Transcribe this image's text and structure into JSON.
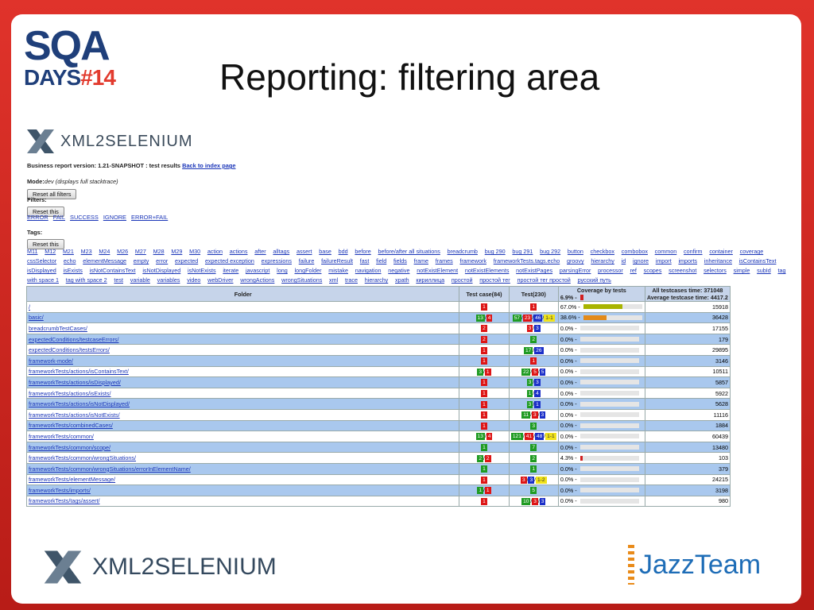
{
  "slide": {
    "title": "Reporting: filtering area",
    "logo_sqa_text": "SQA",
    "logo_days_text": "DAYS",
    "logo_number": "#14",
    "bottom_left_logo": "XML2SELENIUM",
    "bottom_right_logo": "JazzTeam"
  },
  "report": {
    "logo_text": "XML2SELENIUM",
    "version_line": "Business report version: 1.21-SNAPSHOT : test results",
    "back_link": "Back to index page",
    "mode_label": "Mode:",
    "mode_value": "dev (displays full stacktrace)",
    "reset_all_filters": "Reset all filters",
    "filters_label": "Filters:",
    "reset_this_1": "Reset this",
    "filter_links": [
      "ERROR",
      "FAIL",
      "SUCCESS",
      "IGNORE",
      "ERROR+FAIL"
    ],
    "tags_label": "Tags:",
    "reset_this_2": "Reset this",
    "tags": [
      "M11",
      "M12",
      "M21",
      "M23",
      "M24",
      "M26",
      "M27",
      "M28",
      "M29",
      "M30",
      "action",
      "actions",
      "after",
      "alltags",
      "assert",
      "base",
      "bdd",
      "before",
      "before/after all situations",
      "breadcrumb",
      "bug 290",
      "bug 291",
      "bug 292",
      "button",
      "checkbox",
      "combobox",
      "common",
      "confirm",
      "container",
      "coverage",
      "cssSelector",
      "echo",
      "elementMessage",
      "empty",
      "error",
      "expected",
      "expected exception",
      "expressions",
      "failure",
      "failureResult",
      "fast",
      "field",
      "fields",
      "frame",
      "frames",
      "framework",
      "frameworkTests.tags.echo",
      "groovy",
      "hierarchy",
      "id",
      "ignore",
      "import",
      "imports",
      "inheritance",
      "isContainsText",
      "isDisplayed",
      "isExists",
      "isNotContainsText",
      "isNotDisplayed",
      "isNotExists",
      "iterate",
      "javascript",
      "long",
      "longFolder",
      "mistake",
      "navigation",
      "negative",
      "notExistElement",
      "notExistElements",
      "notExistPages",
      "parsingError",
      "processor",
      "ref",
      "scopes",
      "screenshot",
      "selectors",
      "simple",
      "subId",
      "tag with space 1",
      "tag with space 2",
      "test",
      "variable",
      "variables",
      "video",
      "webDriver",
      "wrongActions",
      "wrongSituations",
      "xml",
      "trace",
      "hierarchy",
      "xpath",
      "кириллица",
      "простой",
      "простой тег",
      "простой тег простой",
      "русский путь"
    ],
    "table": {
      "headers": {
        "folder": "Folder",
        "test_case": "Test case(84)",
        "test": "Test(230)",
        "coverage": "Coverage by tests",
        "coverage_value": "6.9% -",
        "time": "All testcases time: 371048",
        "avg_time": "Average testcase time: 4417.2"
      },
      "rows": [
        {
          "folder": "/",
          "tc": [
            [
              "r",
              "1"
            ]
          ],
          "t": [
            [
              "r",
              "1"
            ]
          ],
          "cov": "67.0% -",
          "covfrac": 0.67,
          "covcolor": "#a8b400",
          "time": "15918"
        },
        {
          "folder": "basic/",
          "tc": [
            [
              "g",
              "13"
            ],
            [
              "r",
              "4"
            ]
          ],
          "t": [
            [
              "g",
              "57"
            ],
            [
              "r",
              "23"
            ],
            [
              "bl",
              "46"
            ],
            [
              "y",
              "1-1"
            ]
          ],
          "cov": "38.6% -",
          "covfrac": 0.39,
          "covcolor": "#e38a1a",
          "time": "36428"
        },
        {
          "folder": "breadcrumbTestCases/",
          "tc": [
            [
              "r",
              "2"
            ]
          ],
          "t": [
            [
              "r",
              "3"
            ],
            [
              "bl",
              "3"
            ]
          ],
          "cov": "0.0% -",
          "covfrac": 0,
          "covcolor": "#e5e5e5",
          "time": "17155"
        },
        {
          "folder": "expectedConditions/testcaseErrors/",
          "tc": [
            [
              "r",
              "2"
            ]
          ],
          "t": [
            [
              "g",
              "2"
            ]
          ],
          "cov": "0.0% -",
          "covfrac": 0,
          "covcolor": "#e5e5e5",
          "time": "179"
        },
        {
          "folder": "expectedConditions/testsErrors/",
          "tc": [
            [
              "r",
              "1"
            ]
          ],
          "t": [
            [
              "g",
              "17"
            ],
            [
              "bl",
              "26"
            ]
          ],
          "cov": "0.0% -",
          "covfrac": 0,
          "covcolor": "#e5e5e5",
          "time": "29895"
        },
        {
          "folder": "framework-mode/",
          "tc": [
            [
              "r",
              "1"
            ]
          ],
          "t": [
            [
              "r",
              "1"
            ]
          ],
          "cov": "0.0% -",
          "covfrac": 0,
          "covcolor": "#e5e5e5",
          "time": "3146"
        },
        {
          "folder": "frameworkTests/actions/isContainsText/",
          "tc": [
            [
              "g",
              "3"
            ],
            [
              "r",
              "1"
            ]
          ],
          "t": [
            [
              "g",
              "22"
            ],
            [
              "r",
              "5"
            ],
            [
              "bl",
              "5"
            ]
          ],
          "cov": "0.0% -",
          "covfrac": 0,
          "covcolor": "#e5e5e5",
          "time": "10511"
        },
        {
          "folder": "frameworkTests/actions/isDisplayed/",
          "tc": [
            [
              "r",
              "1"
            ]
          ],
          "t": [
            [
              "g",
              "3"
            ],
            [
              "bl",
              "3"
            ]
          ],
          "cov": "0.0% -",
          "covfrac": 0,
          "covcolor": "#e5e5e5",
          "time": "5857"
        },
        {
          "folder": "frameworkTests/actions/isExists/",
          "tc": [
            [
              "r",
              "1"
            ]
          ],
          "t": [
            [
              "g",
              "1"
            ],
            [
              "bl",
              "4"
            ]
          ],
          "cov": "0.0% -",
          "covfrac": 0,
          "covcolor": "#e5e5e5",
          "time": "5922"
        },
        {
          "folder": "frameworkTests/actions/isNotDisplayed/",
          "tc": [
            [
              "r",
              "1"
            ]
          ],
          "t": [
            [
              "g",
              "3"
            ],
            [
              "bl",
              "1"
            ]
          ],
          "cov": "0.0% -",
          "covfrac": 0,
          "covcolor": "#e5e5e5",
          "time": "5628"
        },
        {
          "folder": "frameworkTests/actions/isNotExists/",
          "tc": [
            [
              "r",
              "1"
            ]
          ],
          "t": [
            [
              "g",
              "11"
            ],
            [
              "r",
              "3"
            ],
            [
              "bl",
              "3"
            ]
          ],
          "cov": "0.0% -",
          "covfrac": 0,
          "covcolor": "#e5e5e5",
          "time": "11116"
        },
        {
          "folder": "frameworkTests/combinedCases/",
          "tc": [
            [
              "r",
              "1"
            ]
          ],
          "t": [
            [
              "g",
              "3"
            ]
          ],
          "cov": "0.0% -",
          "covfrac": 0,
          "covcolor": "#e5e5e5",
          "time": "1884"
        },
        {
          "folder": "frameworkTests/common/",
          "tc": [
            [
              "g",
              "13"
            ],
            [
              "r",
              "4"
            ]
          ],
          "t": [
            [
              "g",
              "121"
            ],
            [
              "r",
              "41"
            ],
            [
              "bl",
              "48"
            ],
            [
              "y",
              "1-1"
            ]
          ],
          "cov": "0.0% -",
          "covfrac": 0,
          "covcolor": "#e5e5e5",
          "time": "60439"
        },
        {
          "folder": "frameworkTests/common/scope/",
          "tc": [
            [
              "g",
              "1"
            ]
          ],
          "t": [
            [
              "g",
              "7"
            ]
          ],
          "cov": "0.0% -",
          "covfrac": 0,
          "covcolor": "#e5e5e5",
          "time": "13480"
        },
        {
          "folder": "frameworkTests/common/wrongSituations/",
          "tc": [
            [
              "g",
              "2"
            ],
            [
              "r",
              "2"
            ]
          ],
          "t": [
            [
              "g",
              "2"
            ]
          ],
          "cov": "4.3% -",
          "covfrac": 0.043,
          "covcolor": "#d22020",
          "time": "103"
        },
        {
          "folder": "frameworkTests/common/wrongSituations/errorInElementName/",
          "tc": [
            [
              "g",
              "1"
            ]
          ],
          "t": [
            [
              "g",
              "1"
            ]
          ],
          "cov": "0.0% -",
          "covfrac": 0,
          "covcolor": "#e5e5e5",
          "time": "379"
        },
        {
          "folder": "frameworkTests/elementMessage/",
          "tc": [
            [
              "r",
              "1"
            ]
          ],
          "t": [
            [
              "r",
              "3"
            ],
            [
              "bl",
              "3"
            ],
            [
              "y",
              "1-2"
            ]
          ],
          "cov": "0.0% -",
          "covfrac": 0,
          "covcolor": "#e5e5e5",
          "time": "24215"
        },
        {
          "folder": "frameworkTests/imports/",
          "tc": [
            [
              "g",
              "1"
            ],
            [
              "r",
              "1"
            ]
          ],
          "t": [
            [
              "g",
              "5"
            ]
          ],
          "cov": "0.0% -",
          "covfrac": 0,
          "covcolor": "#e5e5e5",
          "time": "3198"
        },
        {
          "folder": "frameworkTests/tags/assert/",
          "tc": [
            [
              "r",
              "1"
            ]
          ],
          "t": [
            [
              "g",
              "10"
            ],
            [
              "r",
              "3"
            ],
            [
              "bl",
              "3"
            ]
          ],
          "cov": "0.0% -",
          "covfrac": 0,
          "covcolor": "#e5e5e5",
          "time": "980"
        }
      ]
    }
  }
}
